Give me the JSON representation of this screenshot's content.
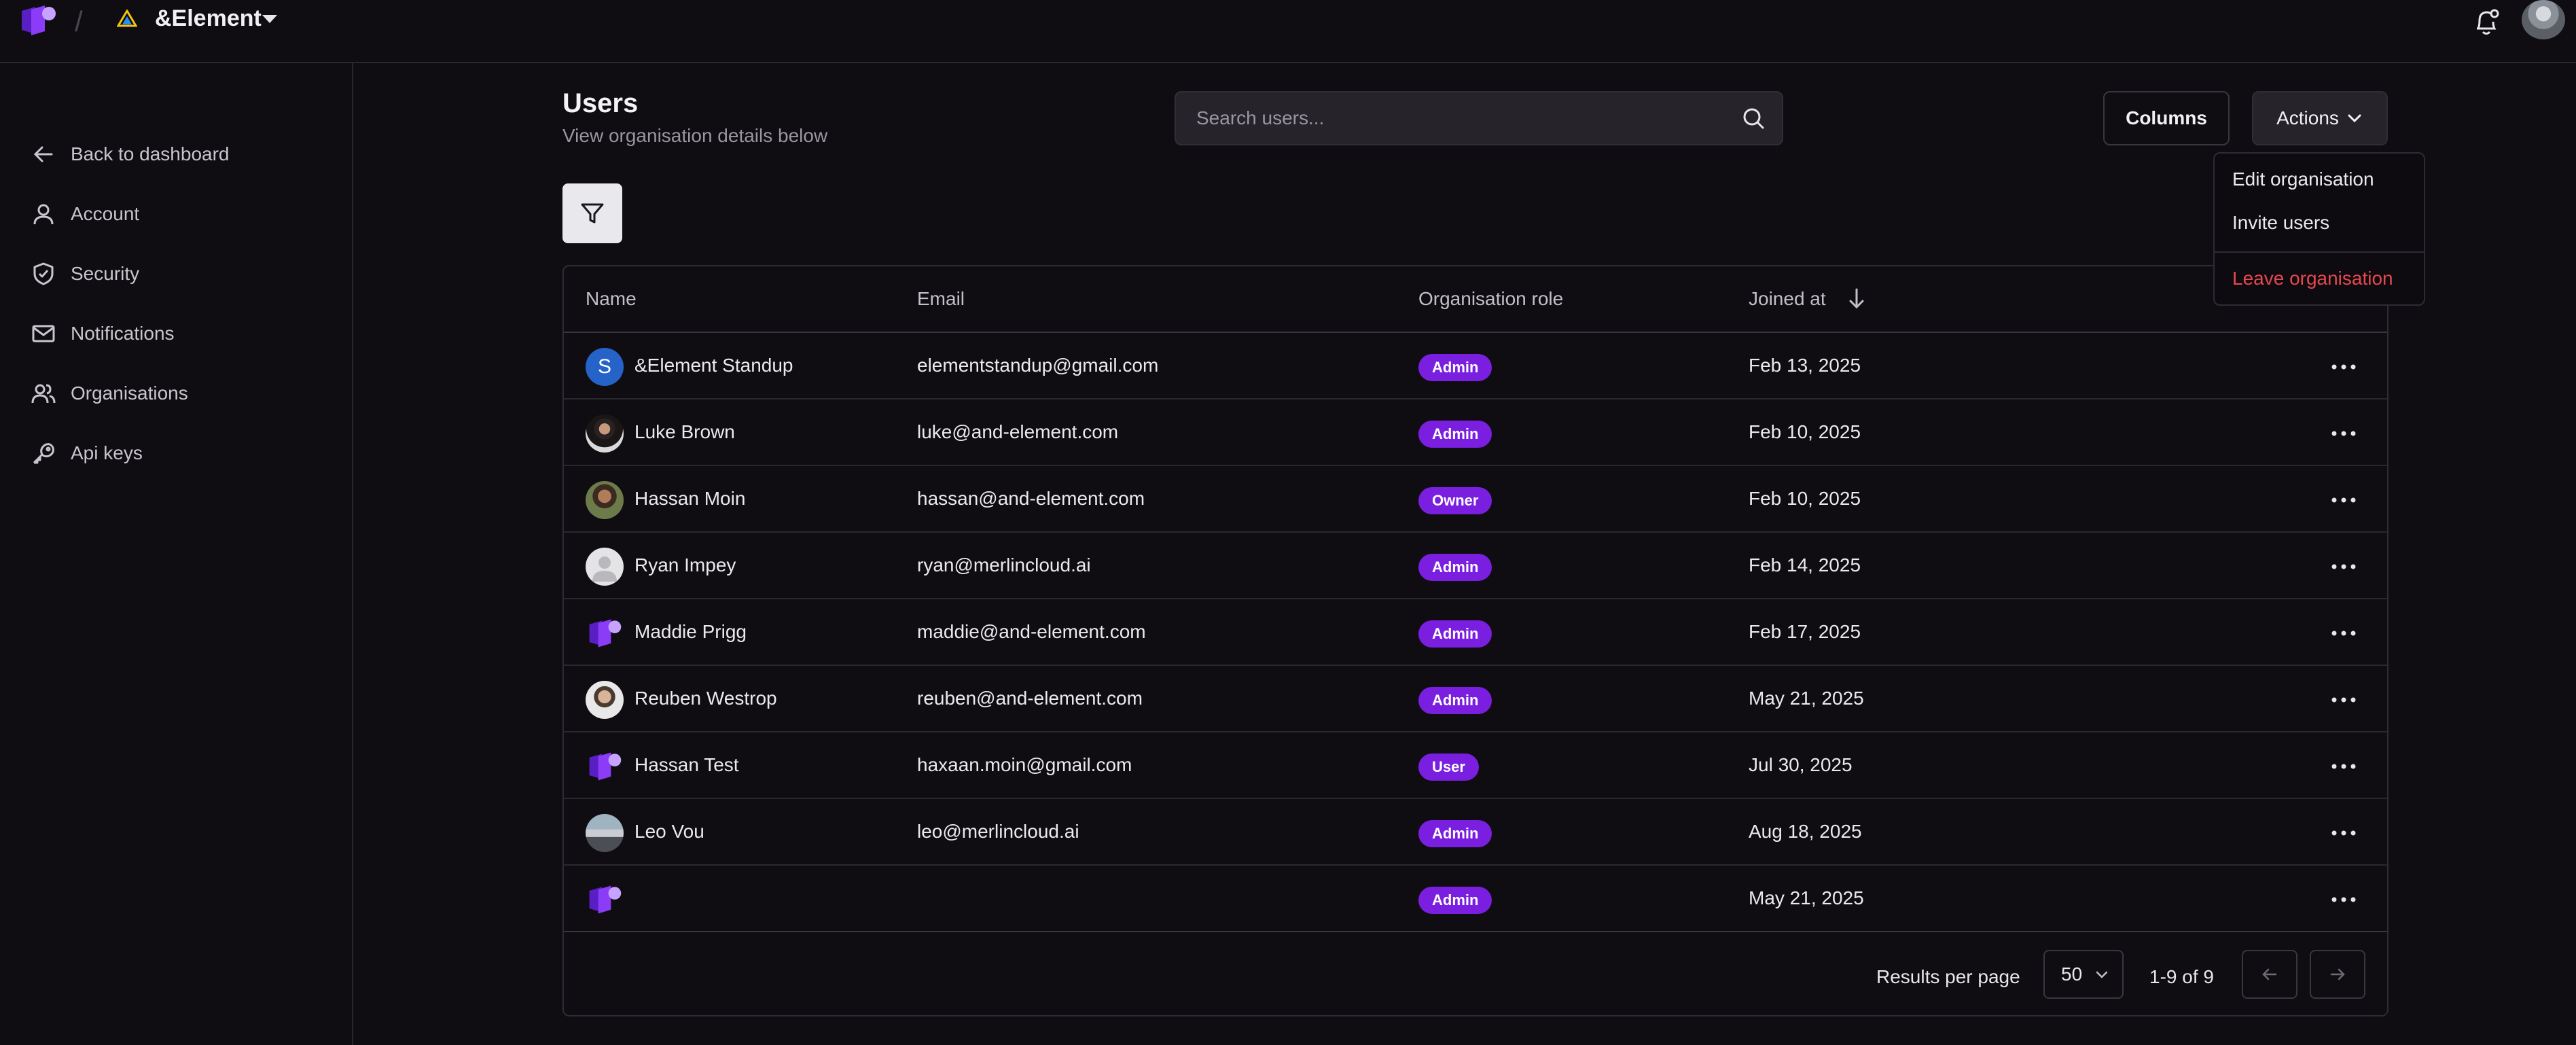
{
  "topbar": {
    "org_name": "&Element"
  },
  "sidebar": {
    "items": [
      {
        "label": "Back to dashboard",
        "icon": "arrow-left-icon"
      },
      {
        "label": "Account",
        "icon": "user-icon"
      },
      {
        "label": "Security",
        "icon": "shield-icon"
      },
      {
        "label": "Notifications",
        "icon": "mail-icon"
      },
      {
        "label": "Organisations",
        "icon": "users-icon"
      },
      {
        "label": "Api keys",
        "icon": "key-icon"
      }
    ]
  },
  "header": {
    "title": "Users",
    "subtitle": "View organisation details below",
    "search_placeholder": "Search users...",
    "columns_label": "Columns",
    "actions_label": "Actions"
  },
  "actions_menu": {
    "edit": "Edit organisation",
    "invite": "Invite users",
    "leave": "Leave organisation"
  },
  "table": {
    "headers": {
      "name": "Name",
      "email": "Email",
      "role": "Organisation role",
      "joined": "Joined at"
    },
    "rows": [
      {
        "name": "&Element Standup",
        "email": "elementstandup@gmail.com",
        "role": "Admin",
        "joined": "Feb 13, 2025",
        "avatar": "letter",
        "initial": "S"
      },
      {
        "name": "Luke Brown",
        "email": "luke@and-element.com",
        "role": "Admin",
        "joined": "Feb 10, 2025",
        "avatar": "photo-dark"
      },
      {
        "name": "Hassan Moin",
        "email": "hassan@and-element.com",
        "role": "Owner",
        "joined": "Feb 10, 2025",
        "avatar": "photo-warm"
      },
      {
        "name": "Ryan Impey",
        "email": "ryan@merlincloud.ai",
        "role": "Admin",
        "joined": "Feb 14, 2025",
        "avatar": "placeholder"
      },
      {
        "name": "Maddie Prigg",
        "email": "maddie@and-element.com",
        "role": "Admin",
        "joined": "Feb 17, 2025",
        "avatar": "logo"
      },
      {
        "name": "Reuben Westrop",
        "email": "reuben@and-element.com",
        "role": "Admin",
        "joined": "May 21, 2025",
        "avatar": "photo-light"
      },
      {
        "name": "Hassan Test",
        "email": "haxaan.moin@gmail.com",
        "role": "User",
        "joined": "Jul 30, 2025",
        "avatar": "logo"
      },
      {
        "name": "Leo Vou",
        "email": "leo@merlincloud.ai",
        "role": "Admin",
        "joined": "Aug 18, 2025",
        "avatar": "photo-car"
      },
      {
        "name": "",
        "email": "",
        "role": "Admin",
        "joined": "May 21, 2025",
        "avatar": "logo"
      }
    ]
  },
  "pagination": {
    "results_label": "Results per page",
    "per_page": "50",
    "range": "1-9 of 9"
  },
  "colors": {
    "background": "#100d12",
    "badge": "#7a1fe0",
    "danger": "#e5484d",
    "brand": "#8b3cf7"
  }
}
